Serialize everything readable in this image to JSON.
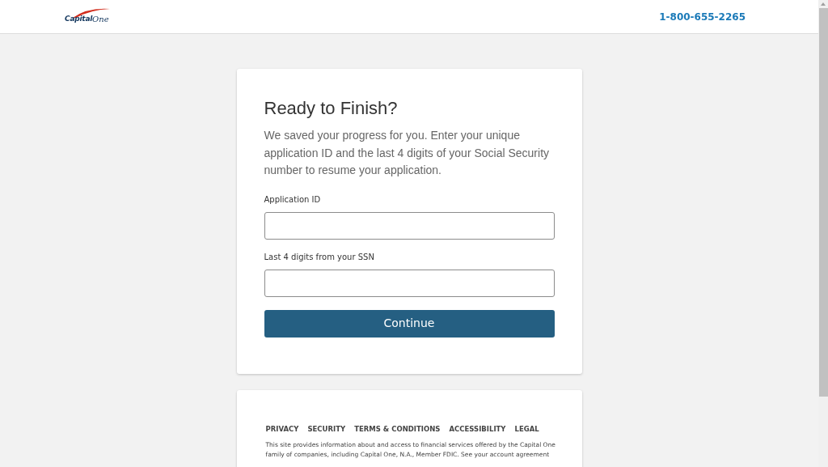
{
  "header": {
    "logo": {
      "word_1": "Capital",
      "word_2": "One"
    },
    "phone": "1-800-655-2265"
  },
  "form": {
    "title": "Ready to Finish?",
    "intro": "We saved your progress for you. Enter your unique application ID and the last 4 digits of your Social Security number to resume your application.",
    "fields": [
      {
        "label": "Application ID"
      },
      {
        "label": "Last 4 digits from your SSN"
      }
    ],
    "button": "Continue"
  },
  "footer": {
    "links": [
      "PRIVACY",
      "SECURITY",
      "TERMS & CONDITIONS",
      "ACCESSIBILITY",
      "LEGAL"
    ],
    "disclaimer": [
      "This site provides information about and access to financial services offered by the Capital One",
      "family of companies, including Capital One, N.A., Member FDIC. See your account agreement"
    ]
  }
}
